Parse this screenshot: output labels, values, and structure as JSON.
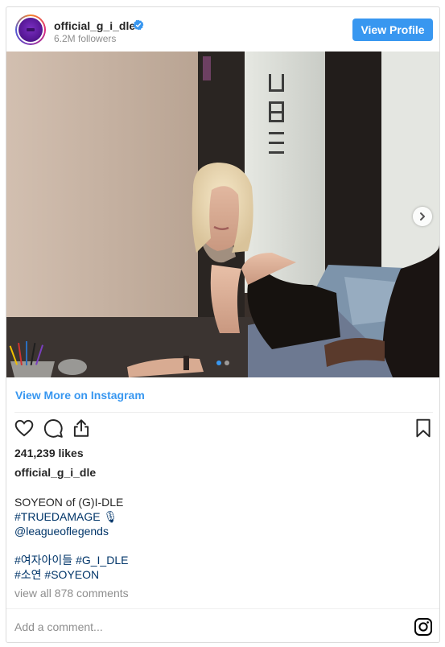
{
  "header": {
    "username": "official_g_i_dle",
    "followers": "6.2M followers",
    "view_profile_label": "View Profile"
  },
  "post": {
    "view_more_label": "View More on Instagram",
    "likes": "241,239 likes",
    "caption_username": "official_g_i_dle",
    "caption_lines": [
      "SOYEON of (G)I-DLE",
      "#TRUEDAMAGE 🎙",
      "@leagueoflegends",
      "",
      "#여자아이들 #G_I_DLE",
      "#소연 #SOYEON"
    ],
    "comments_link": "view all 878 comments",
    "add_comment_placeholder": "Add a comment...",
    "carousel": {
      "total_slides": 2,
      "active_slide": 1
    }
  },
  "icons": {
    "verified": "verified-badge-icon",
    "like": "heart-icon",
    "comment": "comment-bubble-icon",
    "share": "share-icon",
    "save": "bookmark-icon",
    "next": "chevron-right-icon",
    "instagram": "instagram-logo-icon"
  },
  "colors": {
    "accent": "#3897f0",
    "hashtag": "#003569",
    "muted": "#8e8e8e",
    "text": "#262626"
  }
}
